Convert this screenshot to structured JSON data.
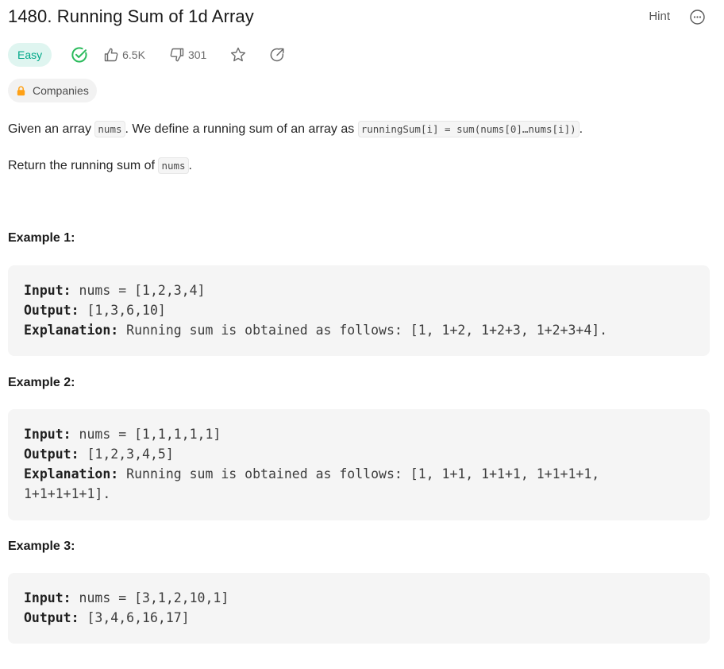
{
  "problem": {
    "title": "1480. Running Sum of 1d Array",
    "hint_label": "Hint",
    "difficulty": "Easy",
    "likes": "6.5K",
    "dislikes": "301",
    "companies_label": "Companies"
  },
  "description": {
    "p1_a": "Given an array ",
    "p1_code1": "nums",
    "p1_b": ". We define a running sum of an array as ",
    "p1_code2": "runningSum[i] = sum(nums[0]…nums[i])",
    "p1_c": ".",
    "p2_a": "Return the running sum of ",
    "p2_code": "nums",
    "p2_b": "."
  },
  "examples": [
    {
      "title": "Example 1:",
      "input_label": "Input:",
      "input": " nums = [1,2,3,4]",
      "output_label": "Output:",
      "output": " [1,3,6,10]",
      "explanation_label": "Explanation:",
      "explanation": " Running sum is obtained as follows: [1, 1+2, 1+2+3, 1+2+3+4]."
    },
    {
      "title": "Example 2:",
      "input_label": "Input:",
      "input": " nums = [1,1,1,1,1]",
      "output_label": "Output:",
      "output": " [1,2,3,4,5]",
      "explanation_label": "Explanation:",
      "explanation": " Running sum is obtained as follows: [1, 1+1, 1+1+1, 1+1+1+1,",
      "explanation_cont": "1+1+1+1+1]."
    },
    {
      "title": "Example 3:",
      "input_label": "Input:",
      "input": " nums = [3,1,2,10,1]",
      "output_label": "Output:",
      "output": " [3,4,6,16,17]"
    }
  ],
  "colors": {
    "easy_text": "#00a888",
    "easy_bg": "#dff5f0",
    "solved_check": "#2cbb5d",
    "lock": "#ffa116"
  },
  "icons": [
    "more-icon",
    "solved-check-icon",
    "thumbs-up-icon",
    "thumbs-down-icon",
    "star-icon",
    "share-icon",
    "lock-icon"
  ]
}
